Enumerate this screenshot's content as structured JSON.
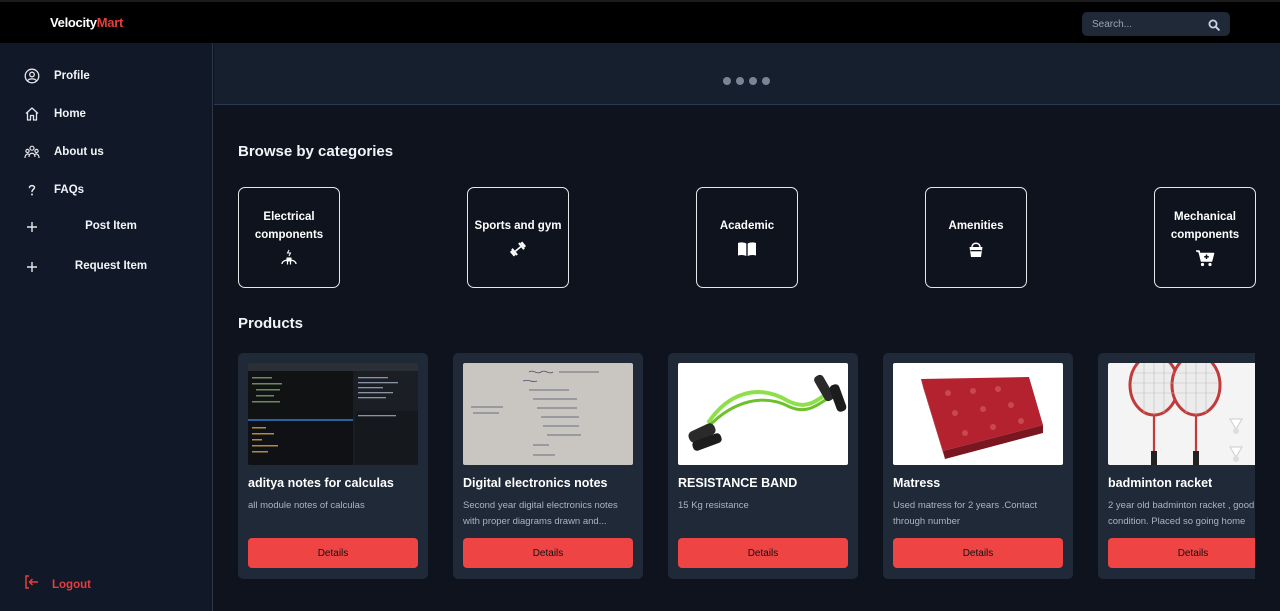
{
  "header": {
    "logo_part1": "Velocity",
    "logo_part2": "Mart",
    "search_placeholder": "Search...",
    "search_icon": "search-icon"
  },
  "sidebar": {
    "items": [
      {
        "label": "Profile",
        "icon": "user-circle-icon"
      },
      {
        "label": "Home",
        "icon": "home-icon"
      },
      {
        "label": "About us",
        "icon": "users-icon"
      },
      {
        "label": "FAQs",
        "icon": "question-icon"
      },
      {
        "label": "Post Item",
        "icon": "plus-icon"
      },
      {
        "label": "Request Item",
        "icon": "plus-icon"
      }
    ],
    "logout_label": "Logout",
    "logout_icon": "logout-icon"
  },
  "carousel": {
    "dot_count": 4
  },
  "categories": {
    "title": "Browse by categories",
    "items": [
      {
        "label": "Electrical components",
        "icon": "plug-icon"
      },
      {
        "label": "Sports and gym",
        "icon": "dumbbell-icon"
      },
      {
        "label": "Academic",
        "icon": "book-icon"
      },
      {
        "label": "Amenities",
        "icon": "bucket-icon"
      },
      {
        "label": "Mechanical components",
        "icon": "cart-icon"
      }
    ]
  },
  "products": {
    "title": "Products",
    "button_label": "Details",
    "items": [
      {
        "title": "aditya notes for calculas",
        "description": "all module notes of calculas"
      },
      {
        "title": "Digital electronics notes",
        "description": "Second year digital electronics notes with proper diagrams drawn and..."
      },
      {
        "title": "RESISTANCE BAND",
        "description": "15 Kg resistance"
      },
      {
        "title": "Matress",
        "description": "Used matress for 2 years .Contact through number"
      },
      {
        "title": "badminton racket",
        "description": "2 year old badminton racket , good condition. Placed so going home"
      }
    ]
  },
  "colors": {
    "accent": "#e53e3e",
    "button": "#ef4444",
    "card": "#1f2937",
    "sidebar": "#111827",
    "background": "#0e131d"
  }
}
